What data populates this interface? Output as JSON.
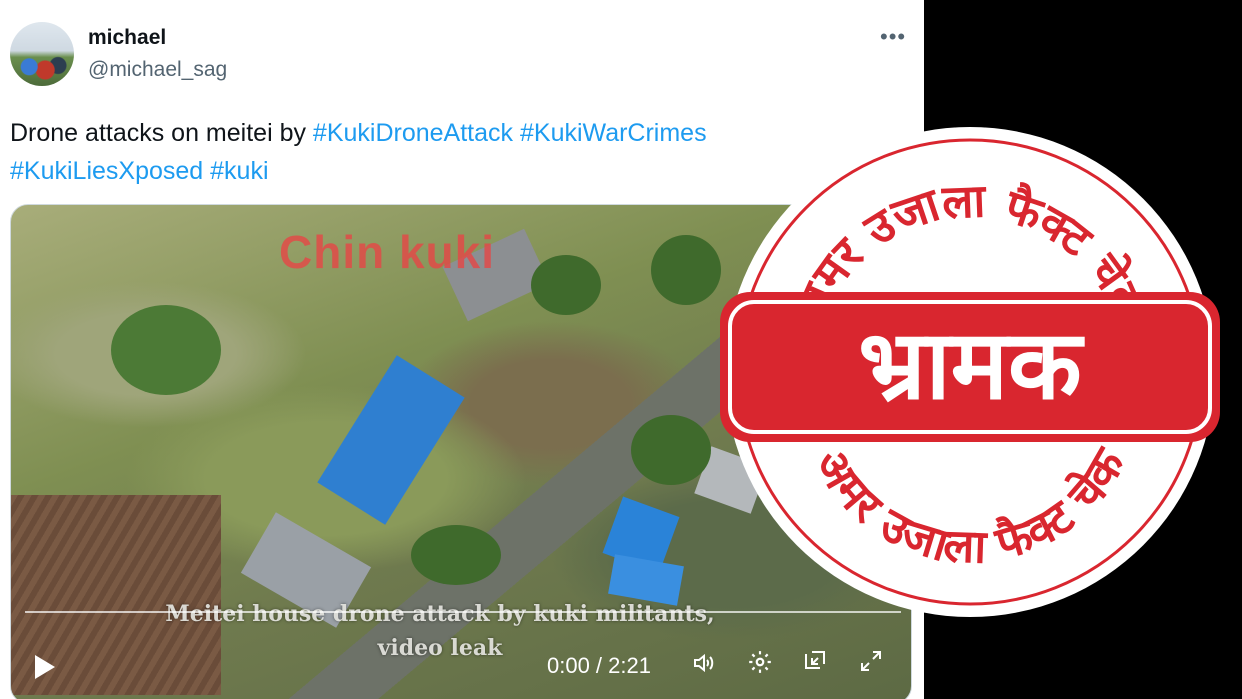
{
  "tweet": {
    "display_name": "michael",
    "handle": "@michael_sag",
    "more_label": "•••",
    "text_plain": "Drone attacks on meitei by ",
    "hashtags": [
      "#KukiDroneAttack",
      "#KukiWarCrimes",
      "#KukiLiesXposed",
      "#kuki"
    ]
  },
  "video": {
    "overlay_title": "Chin kuki",
    "caption_line1": "Meitei house drone attack by kuki militants,",
    "caption_line2": "video leak",
    "current_time": "0:00",
    "duration": "2:21",
    "time_display": "0:00 / 2:21",
    "progress": 0
  },
  "icons": {
    "play": "play-icon",
    "volume": "volume-icon",
    "settings": "gear-icon",
    "pip": "picture-in-picture-icon",
    "fullscreen": "fullscreen-icon"
  },
  "stamp": {
    "top_arc": "अमर उजाला फैक्ट चेक",
    "bottom_arc": "अमर उजाला फैक्ट चेक",
    "verdict": "भ्रामक",
    "color": "#d9262f"
  }
}
